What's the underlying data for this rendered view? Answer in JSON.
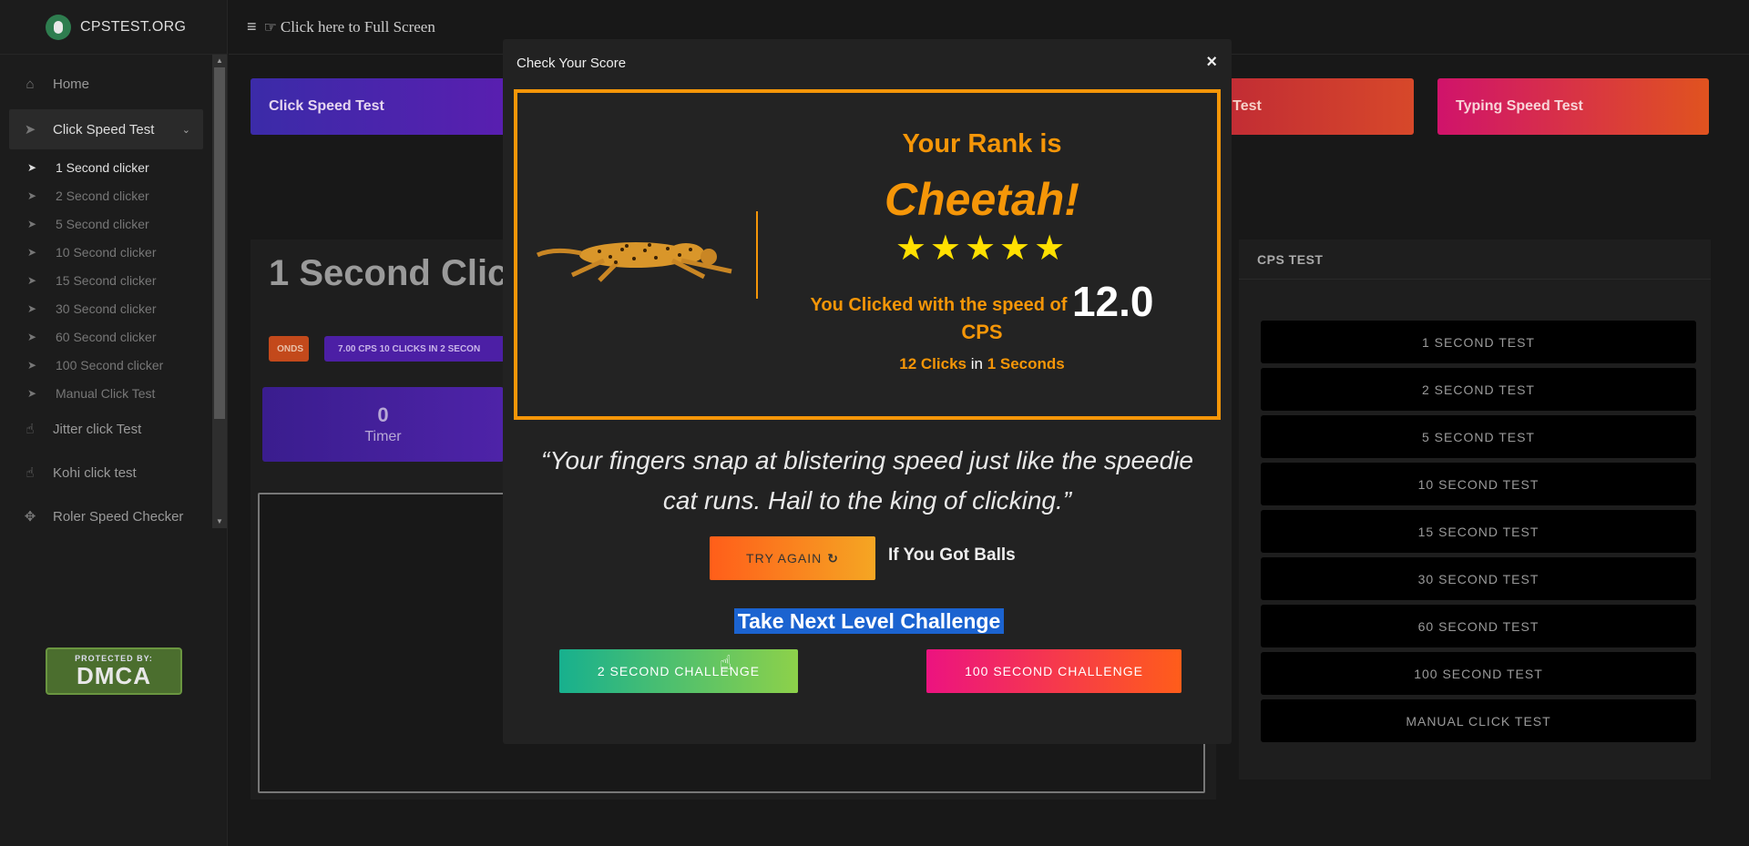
{
  "brand": {
    "name": "CPSTEST.ORG"
  },
  "topbar": {
    "fullscreen_text": "Click here to Full Screen"
  },
  "sidebar": {
    "items": [
      {
        "label": "Home",
        "icon": "home-icon"
      },
      {
        "label": "Click Speed Test",
        "icon": "pointer-icon",
        "expanded": true
      }
    ],
    "sub_items": [
      {
        "label": "1 Second clicker",
        "selected": true
      },
      {
        "label": "2 Second clicker"
      },
      {
        "label": "5 Second clicker"
      },
      {
        "label": "10 Second clicker"
      },
      {
        "label": "15 Second clicker"
      },
      {
        "label": "30 Second clicker"
      },
      {
        "label": "60 Second clicker"
      },
      {
        "label": "100 Second clicker"
      },
      {
        "label": "Manual Click Test"
      }
    ],
    "more_items": [
      {
        "label": "Jitter click Test",
        "icon": "hand-icon"
      },
      {
        "label": "Kohi click test",
        "icon": "hand-icon"
      },
      {
        "label": "Roler Speed Checker",
        "icon": "crosshair-icon"
      }
    ],
    "dmca": {
      "small": "PROTECTED BY:",
      "big": "DMCA"
    }
  },
  "cards": {
    "click_speed": "Click Speed Test",
    "speed_partial": "ed Test",
    "typing": "Typing Speed Test"
  },
  "main": {
    "title": "1 Second Clic",
    "pill_orange": "ONDS",
    "pill_purple": "7.00 CPS 10 CLICKS IN 2 SECON",
    "timer_value": "0",
    "timer_label": "Timer"
  },
  "right_panel": {
    "heading": "CPS TEST",
    "buttons": [
      "1 SECOND TEST",
      "2 SECOND TEST",
      "5 SECOND TEST",
      "10 SECOND TEST",
      "15 SECOND TEST",
      "30 SECOND TEST",
      "60 SECOND TEST",
      "100 SECOND TEST",
      "MANUAL CLICK TEST"
    ]
  },
  "modal": {
    "title": "Check Your Score",
    "close": "×",
    "rank_label": "Your Rank is",
    "rank_name": "Cheetah!",
    "stars": "★★★★★",
    "star_count": 5,
    "speed_prefix": "You Clicked with the speed of",
    "speed_value": "12.0",
    "speed_unit": "CPS",
    "clicks_count": "12",
    "clicks_word": "Clicks",
    "clicks_in": "in",
    "seconds": "1",
    "seconds_word": "Seconds",
    "quote_line1": "“Your fingers snap at blistering speed just like the speedie",
    "quote_line2": "cat runs. Hail to the king of clicking.”",
    "try_again": "TRY AGAIN",
    "balls_text": "If You Got Balls",
    "next_level": "Take Next Level Challenge",
    "challenge_2": "2 SECOND CHALLENGE",
    "challenge_100": "100 SECOND CHALLENGE"
  },
  "colors": {
    "accent_orange": "#f59608",
    "star_yellow": "#ffe000",
    "selection_blue": "#1b63d0"
  }
}
